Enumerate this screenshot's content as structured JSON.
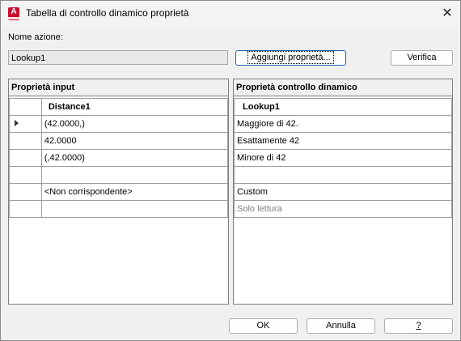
{
  "window": {
    "title": "Tabella di controllo dinamico proprietà",
    "close_glyph": "✕",
    "icon": "autocad-app-icon"
  },
  "action": {
    "label": "Nome azione:",
    "value": "Lookup1"
  },
  "buttons": {
    "add_properties": "Aggiungi proprietà...",
    "verify": "Verifica",
    "ok": "OK",
    "cancel": "Annulla",
    "help": "?"
  },
  "input_panel": {
    "title": "Proprietà input",
    "column": "Distance1",
    "rows": [
      "(42.0000,)",
      "42.0000",
      "(,42.0000)",
      "",
      "<Non corrispondente>",
      ""
    ]
  },
  "lookup_panel": {
    "title": "Proprietà controllo dinamico",
    "column": "Lookup1",
    "rows": [
      "Maggiore di 42.",
      "Esattamente 42",
      "Minore di 42",
      "",
      "Custom",
      "Solo lettura"
    ]
  }
}
